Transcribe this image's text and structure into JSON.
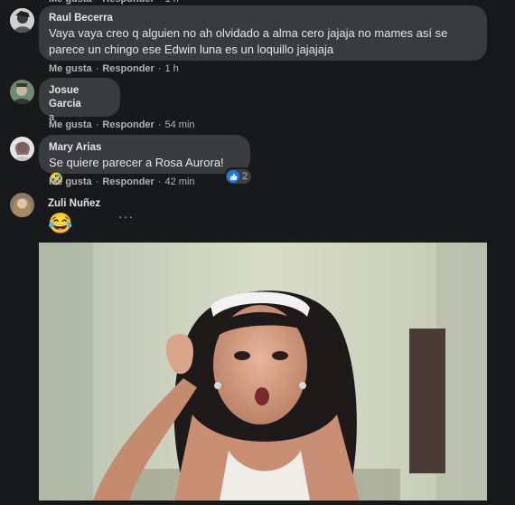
{
  "top_strip": "Me gusta · Responder · 1 h",
  "comments": [
    {
      "author": "Raul Becerra",
      "text_line1": "Vaya vaya creo q alguien no ah olvidado a alma cero jajaja no mames así se",
      "text_line2": "parece un chingo ese Edwin luna es un loquillo jajajaja",
      "like": "Me gusta",
      "reply": "Responder",
      "time": "1 h"
    },
    {
      "author": "Josue Garcia",
      "text": "a",
      "like": "Me gusta",
      "reply": "Responder",
      "time": "54 min"
    },
    {
      "author": "Mary Arias",
      "text": "Se quiere parecer a Rosa Aurora! 🤣",
      "like": "Me gusta",
      "reply": "Responder",
      "time": "42 min",
      "reaction_count": "2"
    },
    {
      "author": "Zuli Nuñez",
      "emoji": "😂",
      "more": "···"
    }
  ],
  "colors": {
    "background": "#18191a",
    "bubble": "#3a3b3c",
    "text": "#e4e6eb",
    "secondary": "#b0b3b8",
    "like_blue": "#1877f2"
  },
  "icons": [
    "like-reaction-icon",
    "more-options-icon"
  ]
}
